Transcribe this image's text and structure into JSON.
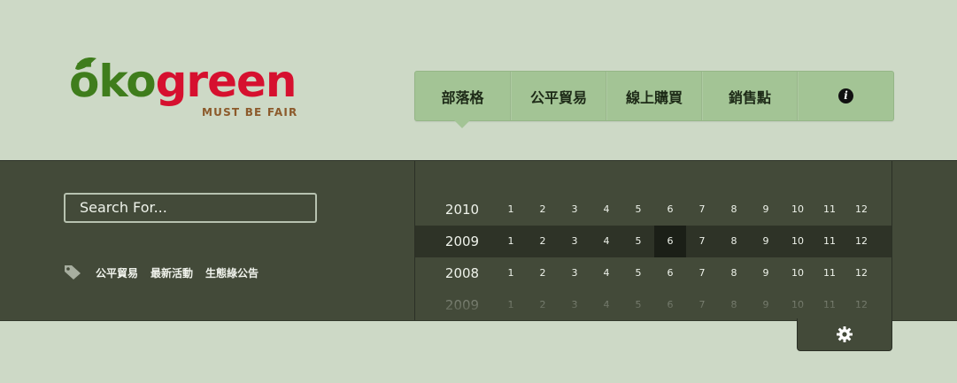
{
  "logo": {
    "oko": "ōko",
    "green": "green",
    "tagline": "MUST BE FAIR"
  },
  "nav": {
    "items": [
      "部落格",
      "公平貿易",
      "線上購買",
      "銷售點"
    ],
    "info_icon": "info-icon"
  },
  "search": {
    "placeholder": "Search For..."
  },
  "tags": {
    "icon": "tag-icon",
    "items": [
      "公平貿易",
      "最新活動",
      "生態綠公告"
    ]
  },
  "archive": {
    "rows": [
      {
        "year": "2010",
        "months": [
          "1",
          "2",
          "3",
          "4",
          "5",
          "6",
          "7",
          "8",
          "9",
          "10",
          "11",
          "12"
        ]
      },
      {
        "year": "2009",
        "months": [
          "1",
          "2",
          "3",
          "4",
          "5",
          "6",
          "7",
          "8",
          "9",
          "10",
          "11",
          "12"
        ],
        "active": true,
        "selected_month": "6"
      },
      {
        "year": "2008",
        "months": [
          "1",
          "2",
          "3",
          "4",
          "5",
          "6",
          "7",
          "8",
          "9",
          "10",
          "11",
          "12"
        ]
      },
      {
        "year": "2009",
        "months": [
          "1",
          "2",
          "3",
          "4",
          "5",
          "6",
          "7",
          "8",
          "9",
          "10",
          "11",
          "12"
        ]
      }
    ]
  },
  "settings": {
    "icon": "gear-icon"
  },
  "colors": {
    "brand_green": "#3f7d1c",
    "brand_red": "#d6102f",
    "tagline_brown": "#8c5a2b",
    "nav_bg": "#a3c495",
    "band_bg": "#434a39",
    "page_bg": "#cdd9c6"
  }
}
